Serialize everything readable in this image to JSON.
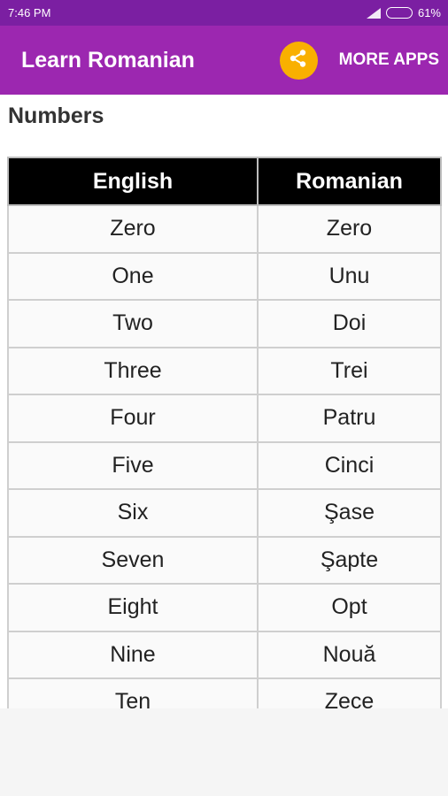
{
  "status_bar": {
    "time": "7:46 PM",
    "battery_percent_label": "61%",
    "battery_level": 0.61,
    "icons": [
      "signal-icon",
      "battery-icon"
    ]
  },
  "app_bar": {
    "title": "Learn Romanian",
    "share_icon": "share-icon",
    "more_apps_label": "MORE APPS"
  },
  "page": {
    "section_title": "Numbers",
    "table": {
      "headers": [
        "English",
        "Romanian"
      ],
      "rows": [
        [
          "Zero",
          "Zero"
        ],
        [
          "One",
          "Unu"
        ],
        [
          "Two",
          "Doi"
        ],
        [
          "Three",
          "Trei"
        ],
        [
          "Four",
          "Patru"
        ],
        [
          "Five",
          "Cinci"
        ],
        [
          "Six",
          "Şase"
        ],
        [
          "Seven",
          "Şapte"
        ],
        [
          "Eight",
          "Opt"
        ],
        [
          "Nine",
          "Nouă"
        ],
        [
          "Ten",
          "Zece"
        ]
      ]
    }
  },
  "colors": {
    "status_bar": "#7b1fa2",
    "app_bar": "#9c27b0",
    "share_button": "#f9b000",
    "table_header": "#000000"
  }
}
